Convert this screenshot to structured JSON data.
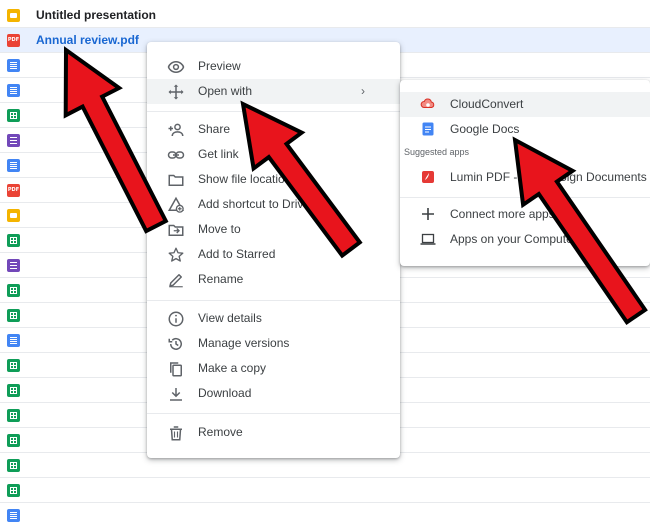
{
  "files": [
    {
      "name": "Untitled presentation",
      "type": "slides"
    },
    {
      "name": "Annual review.pdf",
      "type": "pdf",
      "selected": true
    },
    {
      "name": "",
      "type": "docs"
    },
    {
      "name": "",
      "type": "docs"
    },
    {
      "name": "",
      "type": "sheets"
    },
    {
      "name": "",
      "type": "forms"
    },
    {
      "name": "",
      "type": "docs"
    },
    {
      "name": "",
      "type": "pdf"
    },
    {
      "name": "",
      "type": "slides"
    },
    {
      "name": "",
      "type": "sheets"
    },
    {
      "name": "",
      "type": "forms"
    },
    {
      "name": "",
      "type": "sheets"
    },
    {
      "name": "",
      "type": "sheets"
    },
    {
      "name": "",
      "type": "docs"
    },
    {
      "name": "",
      "type": "sheets"
    },
    {
      "name": "",
      "type": "sheets"
    },
    {
      "name": "",
      "type": "sheets"
    },
    {
      "name": "",
      "type": "sheets"
    },
    {
      "name": "",
      "type": "sheets"
    },
    {
      "name": "",
      "type": "sheets"
    },
    {
      "name": "",
      "type": "docs"
    }
  ],
  "context_menu": {
    "items": [
      {
        "label": "Preview",
        "icon": "eye-icon"
      },
      {
        "label": "Open with",
        "icon": "move-icon",
        "chevron": "›"
      },
      {
        "label": "Share",
        "icon": "person-add-icon"
      },
      {
        "label": "Get link",
        "icon": "link-icon"
      },
      {
        "label": "Show file location",
        "icon": "folder-icon"
      },
      {
        "label": "Add shortcut to Drive",
        "icon": "shortcut-icon"
      },
      {
        "label": "Move to",
        "icon": "move-to-icon"
      },
      {
        "label": "Add to Starred",
        "icon": "star-icon"
      },
      {
        "label": "Rename",
        "icon": "pencil-icon"
      },
      {
        "label": "View details",
        "icon": "info-icon"
      },
      {
        "label": "Manage versions",
        "icon": "history-icon"
      },
      {
        "label": "Make a copy",
        "icon": "copy-icon"
      },
      {
        "label": "Download",
        "icon": "download-icon"
      },
      {
        "label": "Remove",
        "icon": "trash-icon"
      }
    ]
  },
  "submenu": {
    "items": [
      {
        "label": "CloudConvert",
        "icon": "cloudconvert-icon"
      },
      {
        "label": "Google Docs",
        "icon": "google-docs-icon"
      },
      {
        "label": "Lumin PDF - Edit or Sign Documents",
        "icon": "lumin-pdf-icon"
      },
      {
        "label": "Connect more apps",
        "icon": "plus-icon"
      },
      {
        "label": "Apps on your Computer",
        "icon": "laptop-icon"
      }
    ],
    "section_label": "Suggested apps"
  },
  "colors": {
    "selected_row": "#e8f0fe",
    "selected_text": "#1967d2",
    "arrow_fill": "#e8141c",
    "hover": "#f1f3f4"
  }
}
